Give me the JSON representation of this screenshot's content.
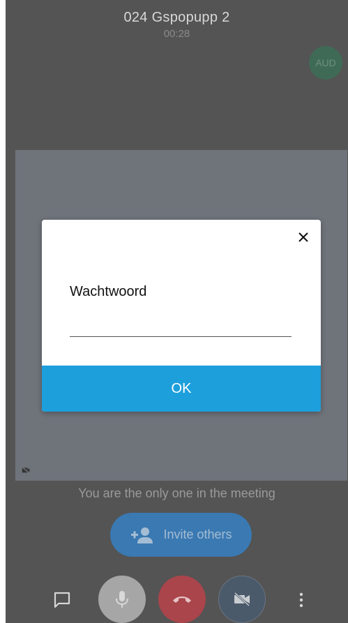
{
  "meeting": {
    "title": "024 Gspopupp 2",
    "timer": "00:28"
  },
  "avatar": {
    "initials": "AUD",
    "color": "#3f6b56"
  },
  "dialog": {
    "label": "Wachtwoord",
    "input_value": "",
    "input_placeholder": "",
    "ok_label": "OK",
    "close_icon": "close-icon",
    "accent": "#1d9fdc"
  },
  "status": {
    "only_one_text": "You are the only one in the meeting"
  },
  "invite": {
    "label": "Invite others",
    "icon": "add-person-icon"
  },
  "toolbar": {
    "items": [
      {
        "icon": "chat-icon"
      },
      {
        "icon": "microphone-icon"
      },
      {
        "icon": "hangup-icon"
      },
      {
        "icon": "video-off-icon"
      },
      {
        "icon": "more-vertical-icon"
      }
    ]
  }
}
